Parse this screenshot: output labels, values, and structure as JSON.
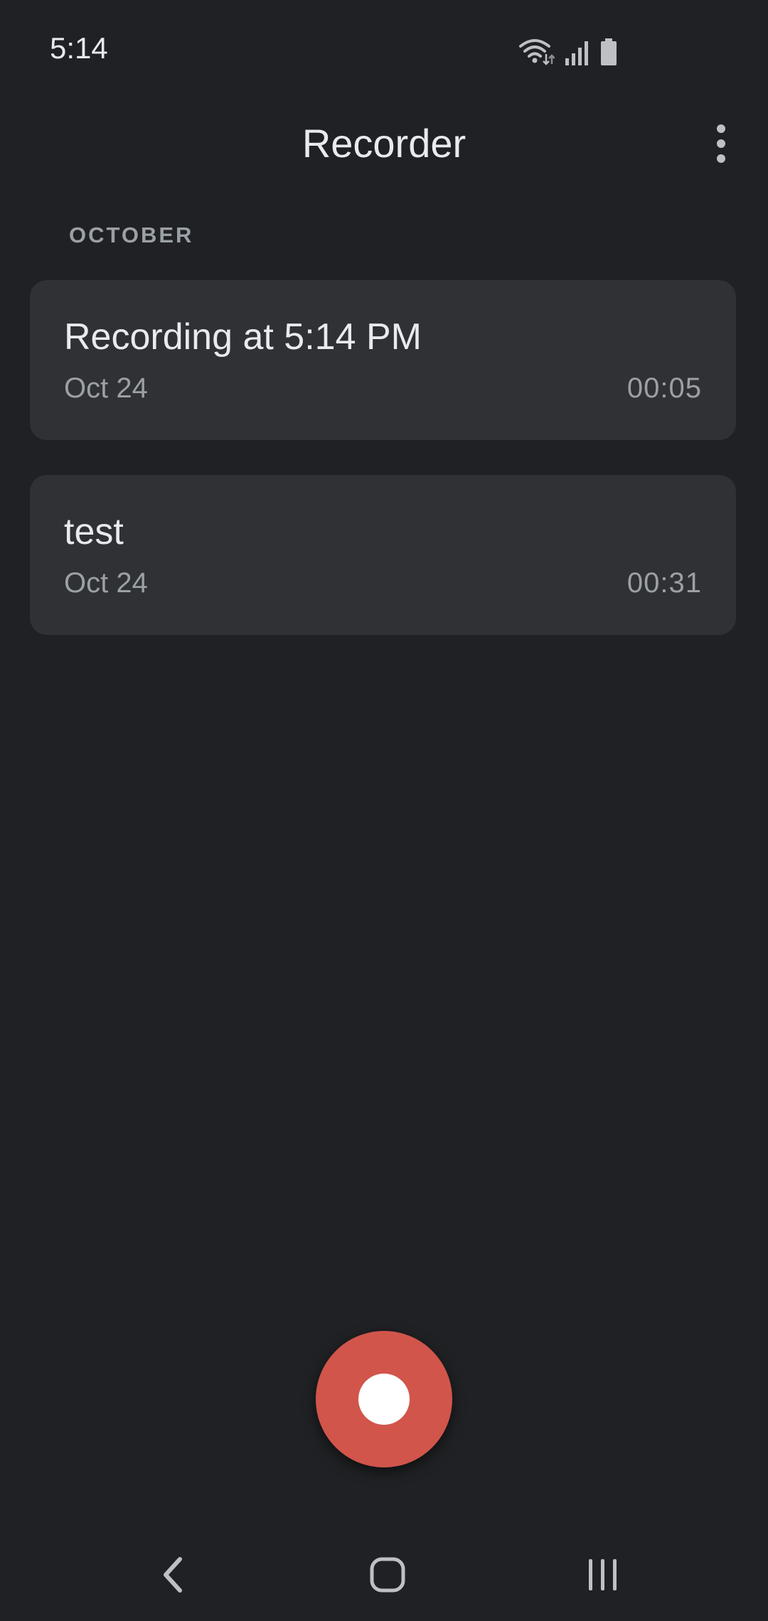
{
  "status_bar": {
    "time": "5:14",
    "icons": [
      "wifi-icon",
      "cellular-signal-icon",
      "battery-icon"
    ]
  },
  "app_bar": {
    "title": "Recorder",
    "menu_icon": "more-vert-icon"
  },
  "section": {
    "header": "OCTOBER"
  },
  "recordings": [
    {
      "title": "Recording at 5:14 PM",
      "date": "Oct 24",
      "duration": "00:05"
    },
    {
      "title": "test",
      "date": "Oct 24",
      "duration": "00:31"
    }
  ],
  "fab": {
    "icon": "record-icon",
    "color": "#d1554b"
  },
  "navigation": {
    "buttons": [
      "back-icon",
      "home-icon",
      "recents-icon"
    ]
  },
  "colors": {
    "background": "#202124",
    "card": "#303134",
    "primary_text": "#e8eaed",
    "secondary_text": "#9aa0a6",
    "accent": "#d1554b"
  }
}
